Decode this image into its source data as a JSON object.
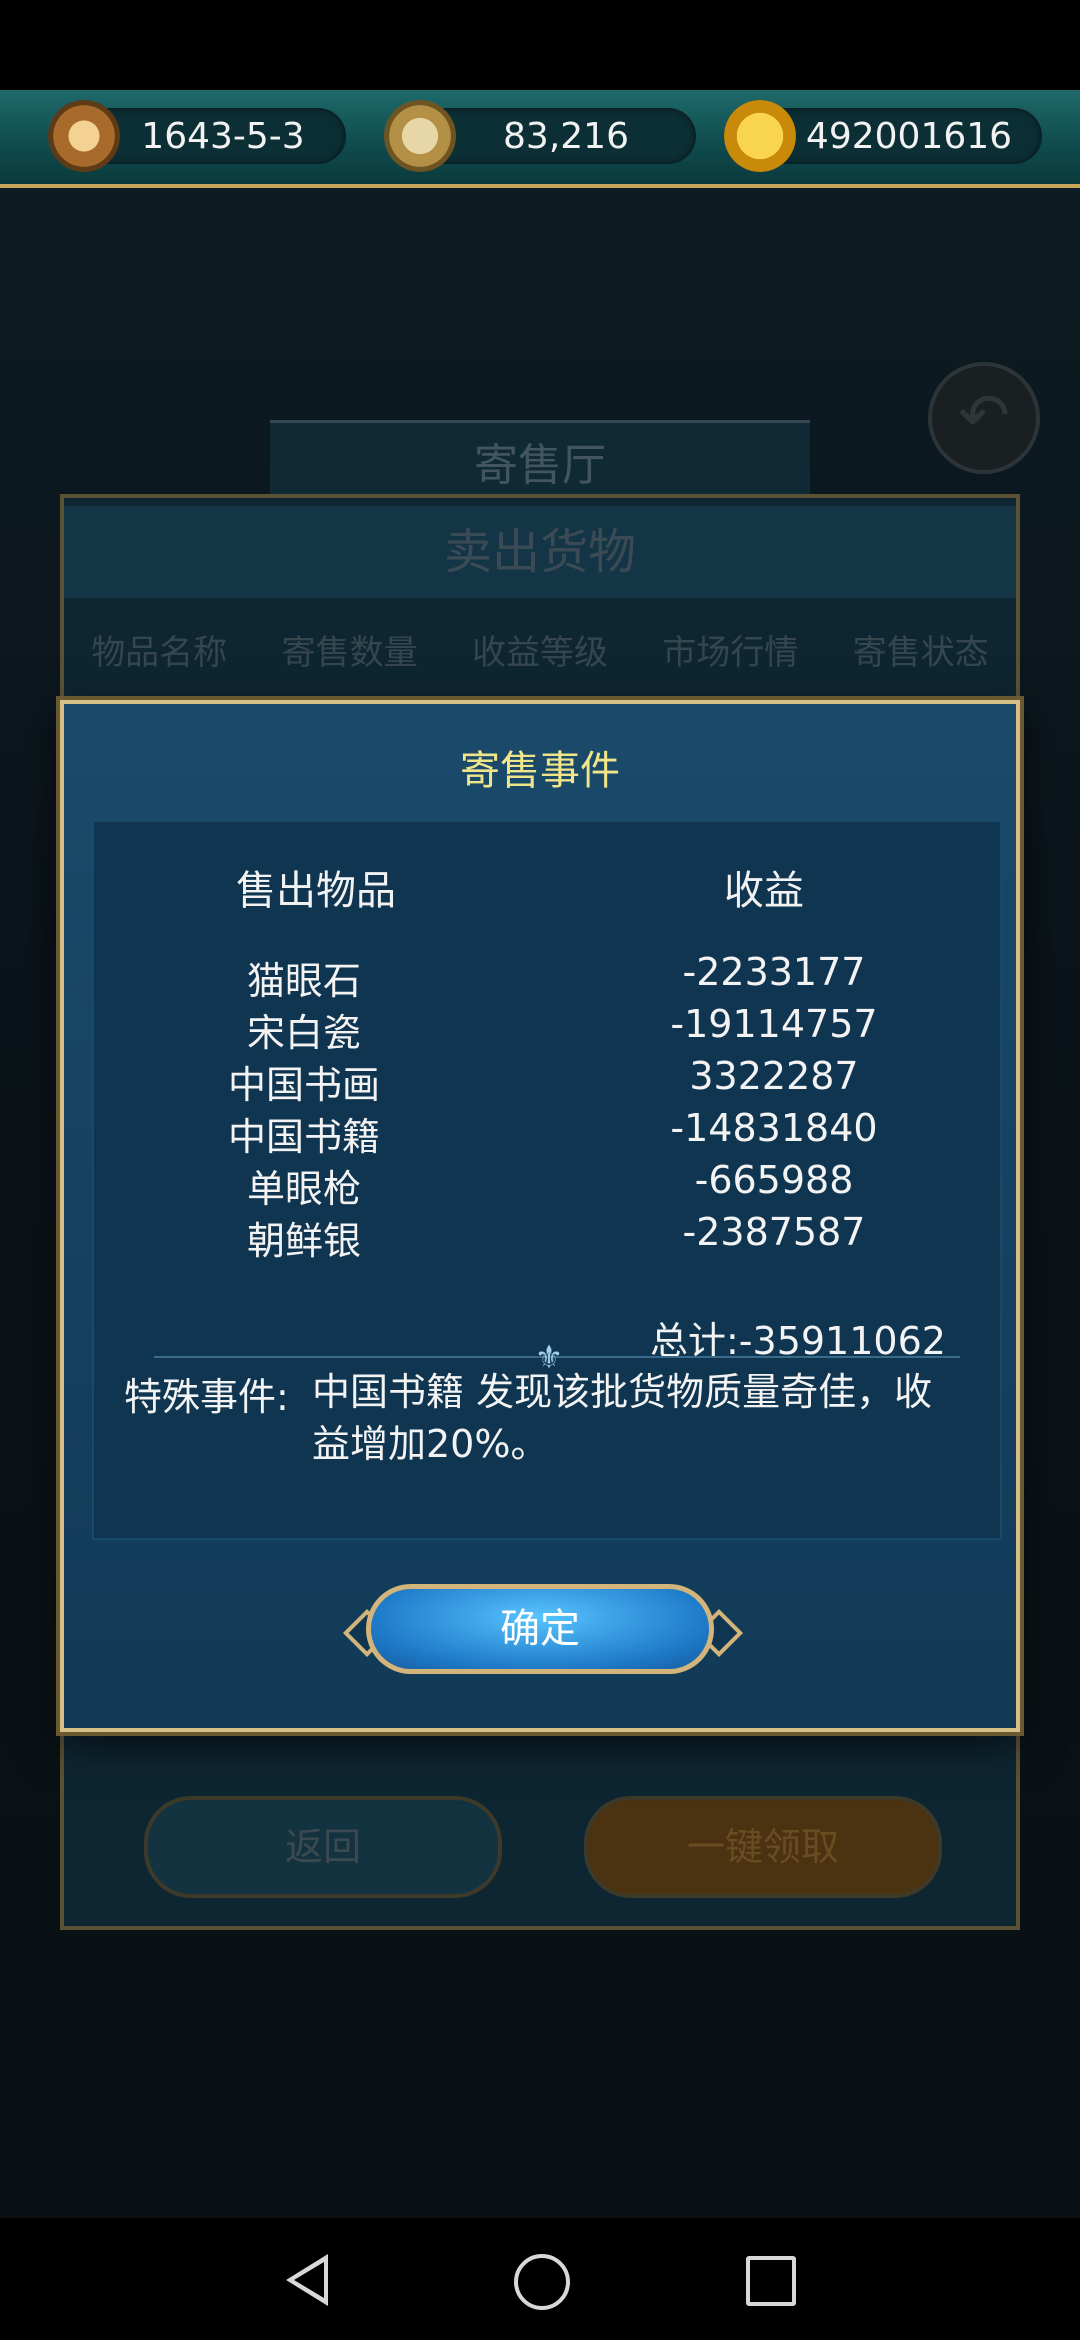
{
  "resources": {
    "date": "1643-5-3",
    "compass_value": "83,216",
    "gold": "492001616"
  },
  "background": {
    "hall_title": "寄售厅",
    "panel_title": "卖出货物",
    "columns": [
      "物品名称",
      "寄售数量",
      "收益等级",
      "市场行情",
      "寄售状态"
    ],
    "return_label": "返回",
    "collect_label": "一键领取"
  },
  "modal": {
    "title": "寄售事件",
    "header_item": "售出物品",
    "header_profit": "收益",
    "rows": [
      {
        "item": "猫眼石",
        "profit": "-2233177"
      },
      {
        "item": "宋白瓷",
        "profit": "-19114757"
      },
      {
        "item": "中国书画",
        "profit": "3322287"
      },
      {
        "item": "中国书籍",
        "profit": "-14831840"
      },
      {
        "item": "单眼枪",
        "profit": "-665988"
      },
      {
        "item": "朝鲜银",
        "profit": "-2387587"
      }
    ],
    "total": "总计:-35911062",
    "special_label": "特殊事件:",
    "special_text": "中国书籍  发现该批货物质量奇佳，收益增加20%。",
    "confirm_label": "确定"
  },
  "colors": {
    "title_yellow": "#f1e58a",
    "frame_gold": "#d8bf86",
    "button_blue": "#1e7ac8"
  }
}
